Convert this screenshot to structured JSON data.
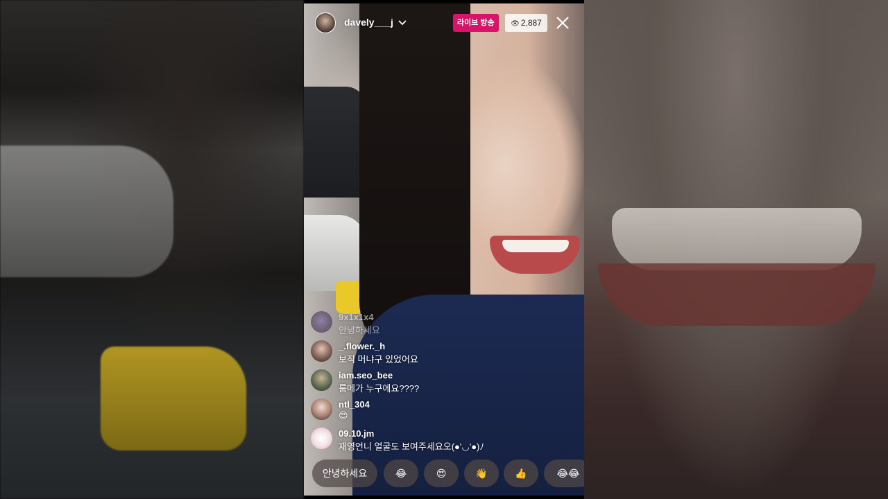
{
  "host": {
    "username": "davely___j",
    "avatar_icon": "profile-photo"
  },
  "badges": {
    "live_label": "라이브 방송",
    "viewer_count": "2,887"
  },
  "colors": {
    "live_badge": "#d8146a",
    "overlay_text": "#ffffff"
  },
  "comments": [
    {
      "user": "9x1x1x4",
      "text": "안녕하세요",
      "avatar": "purple-figure-avatar"
    },
    {
      "user": "_.flower._h",
      "text": "보직 머냐구 있었어요",
      "avatar": "girl-avatar"
    },
    {
      "user": "iam.seo_bee",
      "text": "룸메가 누구에요????",
      "avatar": "man-avatar"
    },
    {
      "user": "ntl_304",
      "text": "😍",
      "avatar": "girl-avatar"
    },
    {
      "user": "09.10.jm",
      "text": "재영언니 얼굴도 보여주세요오(●'◡'●)ﾉ",
      "avatar": "white-dog-avatar"
    }
  ],
  "quick_replies": {
    "text": "안녕하세요",
    "emoji_1": "😂",
    "emoji_2": "😍",
    "emoji_3": "👋",
    "emoji_4": "👍",
    "emoji_5": "😂😂"
  }
}
